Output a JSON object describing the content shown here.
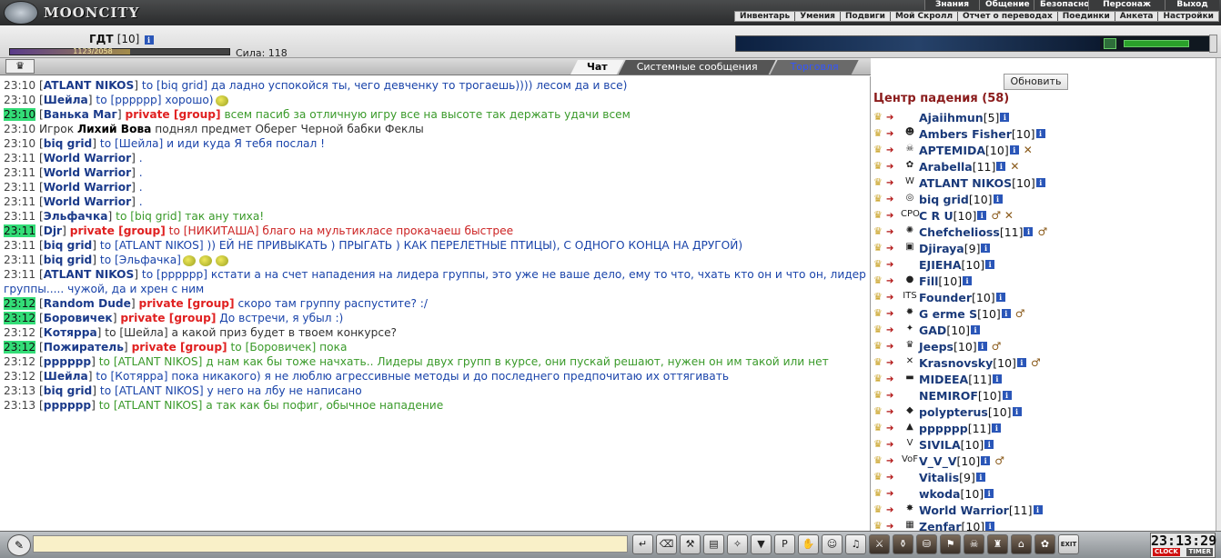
{
  "app": {
    "logo_text": "MOONCITY"
  },
  "menu1": [
    "Знания",
    "Общение",
    "Безопасность",
    "Персонаж",
    "Выход"
  ],
  "menu2": [
    "Инвентарь",
    "Умения",
    "Подвиги",
    "Мой Скролл",
    "Отчет о переводах",
    "Поединки",
    "Анкета",
    "Настройки"
  ],
  "player": {
    "name": "ГДТ",
    "level": "[10]",
    "hp_text": "1123/2058",
    "hp_fraction": 0.546,
    "strength_text": "Сила: 118"
  },
  "tabs": [
    "Чат",
    "Системные сообщения",
    "Торговля"
  ],
  "chat": [
    {
      "t": "23:10",
      "hl": false,
      "segs": [
        [
          "br",
          "["
        ],
        [
          "user",
          "ATLANT NIKOS"
        ],
        [
          "br",
          "]"
        ],
        [
          "c-blue",
          " to [biq grid] да ладно успокойся ты, чего девченку то трогаешь)))) лесом да и все)"
        ]
      ]
    },
    {
      "t": "23:10",
      "hl": false,
      "smile": 1,
      "segs": [
        [
          "br",
          "["
        ],
        [
          "user",
          "Шейла"
        ],
        [
          "br",
          "]"
        ],
        [
          "c-blue",
          " to [pppppp] хорошо)"
        ]
      ]
    },
    {
      "t": "23:10",
      "hl": true,
      "segs": [
        [
          "br",
          "["
        ],
        [
          "user",
          "Ванька Маг"
        ],
        [
          "br",
          "] "
        ],
        [
          "priv",
          "private [group]"
        ],
        [
          "c-green",
          " всем пасиб за отличную игру все на высоте так держать удачи всем"
        ]
      ]
    },
    {
      "t": "23:10",
      "hl": false,
      "segs": [
        [
          "sys",
          " Игрок "
        ],
        [
          "bold",
          "Лихий Вова"
        ],
        [
          "sys",
          " поднял предмет Оберег Черной бабки Феклы"
        ]
      ]
    },
    {
      "t": "23:10",
      "hl": false,
      "segs": [
        [
          "br",
          "["
        ],
        [
          "user",
          "biq grid"
        ],
        [
          "br",
          "]"
        ],
        [
          "c-blue",
          " to [Шейла] и иди куда Я тебя послал !"
        ]
      ]
    },
    {
      "t": "23:11",
      "hl": false,
      "segs": [
        [
          "br",
          "["
        ],
        [
          "user",
          "World Warrior"
        ],
        [
          "br",
          "]"
        ],
        [
          "c-blue",
          " ."
        ]
      ]
    },
    {
      "t": "23:11",
      "hl": false,
      "segs": [
        [
          "br",
          "["
        ],
        [
          "user",
          "World Warrior"
        ],
        [
          "br",
          "]"
        ],
        [
          "c-blue",
          " ."
        ]
      ]
    },
    {
      "t": "23:11",
      "hl": false,
      "segs": [
        [
          "br",
          "["
        ],
        [
          "user",
          "World Warrior"
        ],
        [
          "br",
          "]"
        ],
        [
          "c-blue",
          " ."
        ]
      ]
    },
    {
      "t": "23:11",
      "hl": false,
      "segs": [
        [
          "br",
          "["
        ],
        [
          "user",
          "World Warrior"
        ],
        [
          "br",
          "]"
        ],
        [
          "c-blue",
          " ."
        ]
      ]
    },
    {
      "t": "23:11",
      "hl": false,
      "segs": [
        [
          "br",
          "["
        ],
        [
          "user",
          "Эльфачка"
        ],
        [
          "br",
          "]"
        ],
        [
          "c-green",
          " to [biq grid] так ану тиха!"
        ]
      ]
    },
    {
      "t": "23:11",
      "hl": true,
      "segs": [
        [
          "br",
          "["
        ],
        [
          "user",
          "Djr"
        ],
        [
          "br",
          "] "
        ],
        [
          "priv",
          "private [group]"
        ],
        [
          "c-red",
          " to [НИКИТАША] благо на мультикласе прокачаеш быстрее"
        ]
      ]
    },
    {
      "t": "23:11",
      "hl": false,
      "segs": [
        [
          "br",
          "["
        ],
        [
          "user",
          "biq grid"
        ],
        [
          "br",
          "]"
        ],
        [
          "c-blue",
          " to [ATLANT NIKOS] )) ЕЙ НЕ ПРИВЫКАТЬ ) ПРЫГАТЬ ) КАК ПЕРЕЛЕТНЫЕ ПТИЦЫ), С ОДНОГО КОНЦА НА ДРУГОЙ)"
        ]
      ]
    },
    {
      "t": "23:11",
      "hl": false,
      "smile": 3,
      "segs": [
        [
          "br",
          "["
        ],
        [
          "user",
          "biq grid"
        ],
        [
          "br",
          "]"
        ],
        [
          "c-blue",
          " to [Эльфачка]"
        ]
      ]
    },
    {
      "t": "23:11",
      "hl": false,
      "segs": [
        [
          "br",
          "["
        ],
        [
          "user",
          "ATLANT NIKOS"
        ],
        [
          "br",
          "]"
        ],
        [
          "c-blue",
          " to [pppppp] кстати а на счет нападения на лидера группы, это уже не ваше дело, ему то что, чхать кто он и что он, лидер грyппы..... чужой, да и хрен с ним"
        ]
      ]
    },
    {
      "t": "23:12",
      "hl": true,
      "segs": [
        [
          "br",
          "["
        ],
        [
          "user",
          "Random Dude"
        ],
        [
          "br",
          "] "
        ],
        [
          "priv",
          "private [group]"
        ],
        [
          "c-blue",
          " скоро там группу распустите? :/"
        ]
      ]
    },
    {
      "t": "23:12",
      "hl": true,
      "segs": [
        [
          "br",
          "["
        ],
        [
          "user",
          "Боровичек"
        ],
        [
          "br",
          "] "
        ],
        [
          "priv",
          "private [group]"
        ],
        [
          "c-blue",
          " До встречи, я убыл :)"
        ]
      ]
    },
    {
      "t": "23:12",
      "hl": false,
      "segs": [
        [
          "br",
          "["
        ],
        [
          "user",
          "Котярра"
        ],
        [
          "br",
          "]"
        ],
        [
          "c-gray",
          " to [Шейла] а какой приз будет в твоем конкурсе?"
        ]
      ]
    },
    {
      "t": "23:12",
      "hl": true,
      "segs": [
        [
          "br",
          "["
        ],
        [
          "user",
          "Пожиратель"
        ],
        [
          "br",
          "] "
        ],
        [
          "priv",
          "private [group]"
        ],
        [
          "c-green",
          " to [Боровичек] пока"
        ]
      ]
    },
    {
      "t": "23:12",
      "hl": false,
      "segs": [
        [
          "br",
          "["
        ],
        [
          "user",
          "pppppp"
        ],
        [
          "br",
          "]"
        ],
        [
          "c-green",
          " to [ATLANT NIKOS] д нам как бы тоже начхать.. Лидеры двух групп в курсе, они пускай решают, нужен он им такой или нет"
        ]
      ]
    },
    {
      "t": "23:12",
      "hl": false,
      "segs": [
        [
          "br",
          "["
        ],
        [
          "user",
          "Шейла"
        ],
        [
          "br",
          "]"
        ],
        [
          "c-blue",
          " to [Котярра] пока никакого) я не люблю агрессивные методы и до последнего предпочитаю их оттягивать"
        ]
      ]
    },
    {
      "t": "23:13",
      "hl": false,
      "segs": [
        [
          "br",
          "["
        ],
        [
          "user",
          "biq grid"
        ],
        [
          "br",
          "]"
        ],
        [
          "c-blue",
          " to [ATLANT NIKOS] у него на лбу не написано"
        ]
      ]
    },
    {
      "t": "23:13",
      "hl": false,
      "segs": [
        [
          "br",
          "["
        ],
        [
          "user",
          "pppppp"
        ],
        [
          "br",
          "]"
        ],
        [
          "c-green",
          " to [ATLANT NIKOS] а так как бы пофиг, обычное нападение"
        ]
      ]
    }
  ],
  "right": {
    "refresh_label": "Обновить",
    "location_title": "Центр падения (58)",
    "players": [
      {
        "clan": "",
        "name": "Ajaiihmun",
        "level": "[5]",
        "extra": ""
      },
      {
        "clan": "☻",
        "name": "Ambers Fisher",
        "level": "[10]",
        "extra": ""
      },
      {
        "clan": "☠",
        "name": "APTEMIDA",
        "level": "[10]",
        "extra": "✕"
      },
      {
        "clan": "✿",
        "name": "Arabella",
        "level": "[11]",
        "extra": "✕"
      },
      {
        "clan": "W",
        "name": "ATLANT NIKOS",
        "level": "[10]",
        "extra": ""
      },
      {
        "clan": "◎",
        "name": "biq grid",
        "level": "[10]",
        "extra": ""
      },
      {
        "clan": "CPO",
        "name": "C R U",
        "level": "[10]",
        "extra": "♂ ✕"
      },
      {
        "clan": "✺",
        "name": "Chefchelioss",
        "level": "[11]",
        "extra": "♂"
      },
      {
        "clan": "▣",
        "name": "Djiraya",
        "level": "[9]",
        "extra": ""
      },
      {
        "clan": "",
        "name": "EJIEHA",
        "level": "[10]",
        "extra": ""
      },
      {
        "clan": "●",
        "name": "Fill",
        "level": "[10]",
        "extra": ""
      },
      {
        "clan": "ITS",
        "name": "Founder",
        "level": "[10]",
        "extra": ""
      },
      {
        "clan": "✹",
        "name": "G erme S",
        "level": "[10]",
        "extra": "♂"
      },
      {
        "clan": "✦",
        "name": "GAD",
        "level": "[10]",
        "extra": ""
      },
      {
        "clan": "♛",
        "name": "Jeeps",
        "level": "[10]",
        "extra": "♂"
      },
      {
        "clan": "✕",
        "name": "Krasnovsky",
        "level": "[10]",
        "extra": "♂"
      },
      {
        "clan": "▬",
        "name": "MIDEEA",
        "level": "[11]",
        "extra": ""
      },
      {
        "clan": "",
        "name": "NEMIROF",
        "level": "[10]",
        "extra": ""
      },
      {
        "clan": "◆",
        "name": "polypterus",
        "level": "[10]",
        "extra": ""
      },
      {
        "clan": "▲",
        "name": "pppppp",
        "level": "[11]",
        "extra": ""
      },
      {
        "clan": "V",
        "name": "SIVILA",
        "level": "[10]",
        "extra": ""
      },
      {
        "clan": "VoF",
        "name": "V_V_V",
        "level": "[10]",
        "extra": "♂"
      },
      {
        "clan": "",
        "name": "Vitalis",
        "level": "[9]",
        "extra": ""
      },
      {
        "clan": "",
        "name": "wkoda",
        "level": "[10]",
        "extra": ""
      },
      {
        "clan": "✸",
        "name": "World Warrior",
        "level": "[11]",
        "extra": ""
      },
      {
        "clan": "▦",
        "name": "Zenfar",
        "level": "[10]",
        "extra": ""
      }
    ]
  },
  "bottom": {
    "clock": "23:13:29",
    "clock_left": "CLOCK",
    "clock_right": "TIMER",
    "exit_label": "EXIT"
  },
  "colors": {
    "highlight": "#33dd77",
    "private": "#e02020",
    "location": "#8a1a1a"
  }
}
